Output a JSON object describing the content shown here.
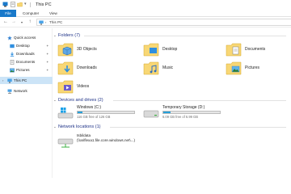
{
  "window": {
    "title": "This PC"
  },
  "ribbon": {
    "tabs": [
      "File",
      "Computer",
      "View"
    ]
  },
  "address": {
    "crumbs": [
      "This PC"
    ]
  },
  "sidebar": {
    "items": [
      {
        "label": "Quick access",
        "icon": "star-icon",
        "pinned": false
      },
      {
        "label": "Desktop",
        "icon": "desktop-folder-icon",
        "pinned": true
      },
      {
        "label": "Downloads",
        "icon": "downloads-folder-icon",
        "pinned": true
      },
      {
        "label": "Documents",
        "icon": "documents-folder-icon",
        "pinned": true
      },
      {
        "label": "Pictures",
        "icon": "pictures-folder-icon",
        "pinned": true
      },
      {
        "label": "This PC",
        "icon": "computer-icon",
        "selected": true
      },
      {
        "label": "Network",
        "icon": "network-icon"
      }
    ]
  },
  "groups": {
    "folders": {
      "title": "Folders (7)"
    },
    "drives": {
      "title": "Devices and drives (2)"
    },
    "network": {
      "title": "Network locations (1)"
    }
  },
  "folders": [
    {
      "label": "3D Objects",
      "icon": "3d-objects-folder-icon"
    },
    {
      "label": "Desktop",
      "icon": "desktop-folder-icon"
    },
    {
      "label": "Documents",
      "icon": "documents-folder-icon"
    },
    {
      "label": "Downloads",
      "icon": "downloads-folder-icon"
    },
    {
      "label": "Music",
      "icon": "music-folder-icon"
    },
    {
      "label": "Pictures",
      "icon": "pictures-folder-icon"
    },
    {
      "label": "Videos",
      "icon": "videos-folder-icon"
    }
  ],
  "drives": [
    {
      "label": "Windows (C:)",
      "space": "116 GB free of 126 GB",
      "used_fraction": 0.08
    },
    {
      "label": "Temporary Storage (D:)",
      "space": "6.09 GB free of 6.99 GB",
      "used_fraction": 0.13
    }
  ],
  "network_locations": [
    {
      "name": "tsbildata",
      "path": "(\\\\ariflexa1.file.core.windows.net\\...)"
    }
  ],
  "colors": {
    "accent": "#1979ca",
    "folder": "#f8d775",
    "selected": "#cce4f7",
    "group_title": "#1e3287",
    "drive_fill": "#26a0da"
  }
}
